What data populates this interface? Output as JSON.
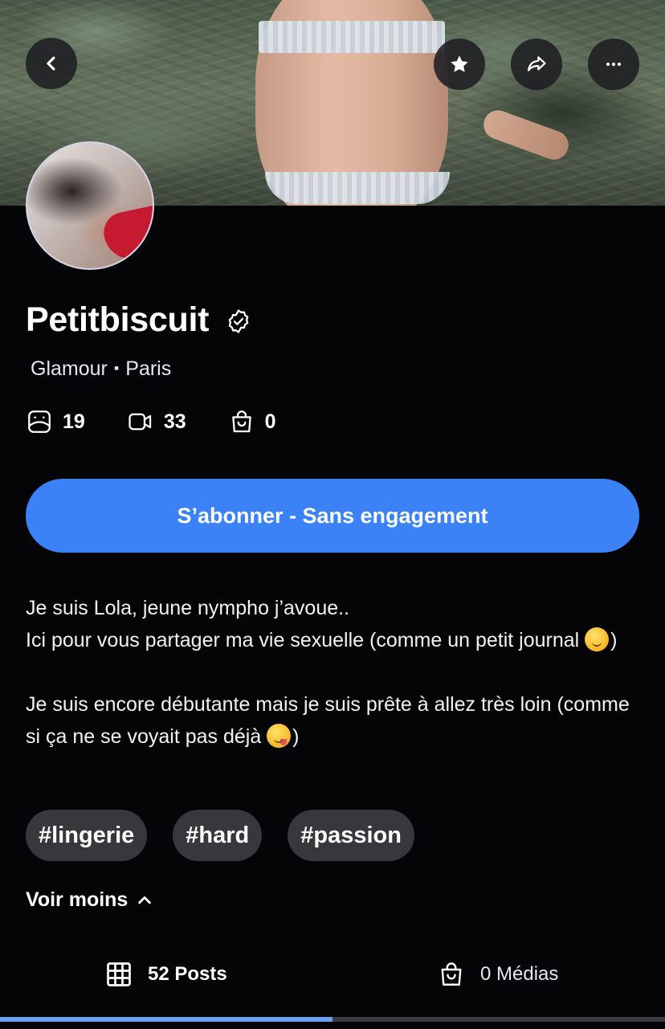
{
  "header": {
    "back_icon": "chevron-left-icon",
    "favorite_icon": "star-icon",
    "share_icon": "share-icon",
    "more_icon": "more-horizontal-icon"
  },
  "profile": {
    "name": "Petitbiscuit",
    "verified_icon": "verified-badge-icon",
    "category": "Glamour",
    "separator": "▪",
    "location": "Paris"
  },
  "stats": [
    {
      "icon": "photo-icon",
      "value": "19"
    },
    {
      "icon": "video-icon",
      "value": "33"
    },
    {
      "icon": "shopping-bag-icon",
      "value": "0"
    }
  ],
  "subscribe_label": "S’abonner - Sans engagement",
  "bio": {
    "p1_text": "Je suis Lola, jeune nympho j’avoue..\nIci pour vous partager ma vie sexuelle (comme un petit journal ",
    "p1_end": ")",
    "p2_text": "Je suis encore débutante mais je suis prête à allez très loin (comme si ça ne se voyait pas déjà ",
    "p2_end": ")"
  },
  "tags": [
    "#lingerie",
    "#hard",
    "#passion"
  ],
  "voir_moins": "Voir moins",
  "tabs": {
    "posts": "52 Posts",
    "medias": "0 Médias"
  },
  "colors": {
    "background": "#050508",
    "accent": "#3b82f6",
    "tag_bg": "#38383c",
    "tab_indicator": "#6ea0f0"
  }
}
